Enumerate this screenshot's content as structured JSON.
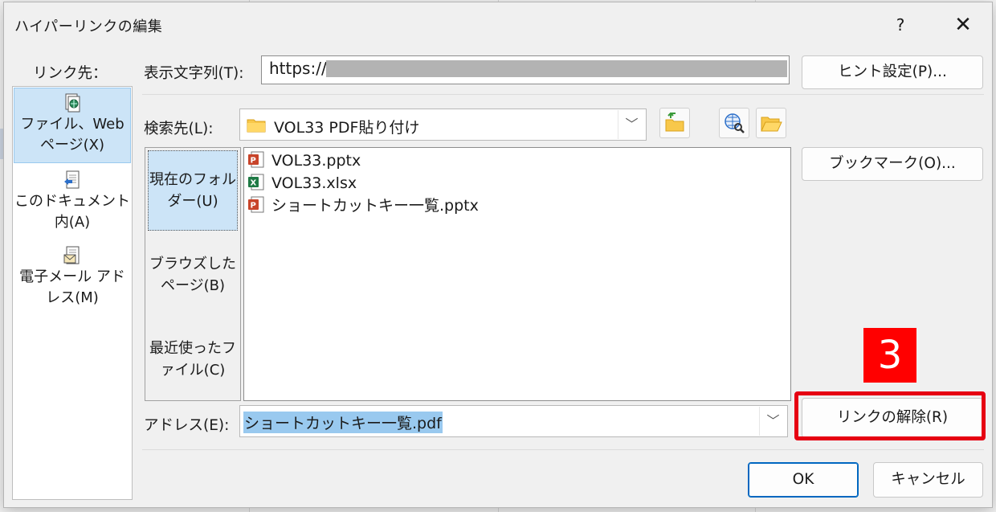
{
  "dialog": {
    "title": "ハイパーリンクの編集",
    "help_label": "?",
    "close_label": "✕"
  },
  "link_to": {
    "label": "リンク先：",
    "items": [
      {
        "label": "ファイル、Web ページ(X)",
        "icon": "file-web-page-icon",
        "selected": true
      },
      {
        "label": "このドキュメント内(A)",
        "icon": "place-in-document-icon",
        "selected": false
      },
      {
        "label": "電子メール アドレス(M)",
        "icon": "email-address-icon",
        "selected": false
      }
    ]
  },
  "display_text": {
    "label": "表示文字列(T):",
    "value": "https://"
  },
  "screentip_button": "ヒント設定(P)...",
  "look_in": {
    "label": "検索先(L):",
    "value": "VOL33 PDF貼り付け"
  },
  "bookmark_button": "ブックマーク(O)...",
  "look_in_panel": {
    "items": [
      {
        "label": "現在のフォルダー(U)",
        "selected": true
      },
      {
        "label": "ブラウズしたページ(B)",
        "selected": false
      },
      {
        "label": "最近使ったファイル(C)",
        "selected": false
      }
    ]
  },
  "files": [
    {
      "name": "VOL33.pptx",
      "icon": "powerpoint-file-icon"
    },
    {
      "name": "VOL33.xlsx",
      "icon": "excel-file-icon"
    },
    {
      "name": "ショートカットキー一覧.pptx",
      "icon": "powerpoint-file-icon"
    }
  ],
  "address": {
    "label": "アドレス(E):",
    "value": "ショートカットキー一覧.pdf"
  },
  "remove_link_button": "リンクの解除(R)",
  "ok_button": "OK",
  "cancel_button": "キャンセル",
  "annotation": {
    "step_number": "3",
    "color": "#ff0000"
  },
  "colors": {
    "selection": "#cce4f7",
    "accent": "#0067c0",
    "highlight_border": "#e60012"
  }
}
